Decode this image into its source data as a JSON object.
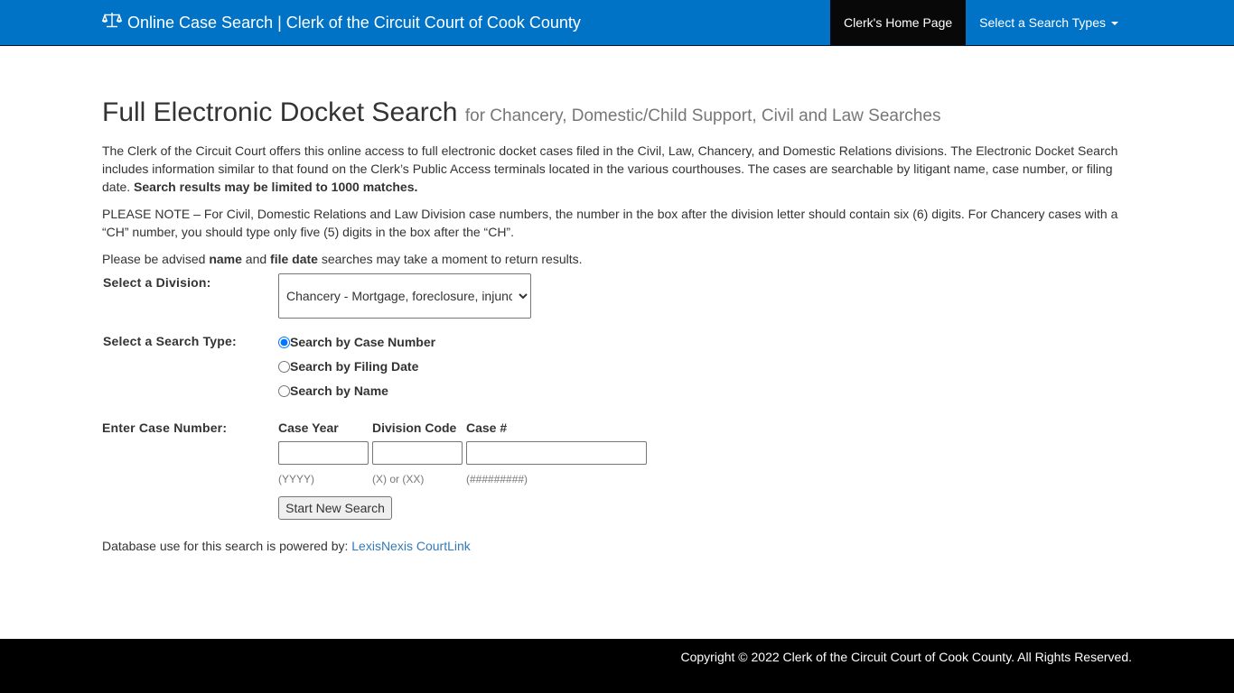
{
  "navbar": {
    "brand_icon": "balance-scale-icon",
    "brand_title": "Online Case Search | Clerk of the Circuit Court of Cook County",
    "home_link": "Clerk's Home Page",
    "search_types_menu": "Select a Search Types",
    "colors": {
      "navbar_bg": "#0073c7",
      "active_bg": "#080808"
    }
  },
  "page": {
    "title": "Full Electronic Docket Search",
    "subtitle": "for Chancery, Domestic/Child Support, Civil and Law Searches",
    "intro_text": "The Clerk of the Circuit Court offers this online access to full electronic docket cases filed in the Civil, Law, Chancery, and Domestic Relations divisions. The Electronic Docket Search includes information similar to that found on the Clerk’s Public Access terminals located in the various courthouses. The cases are searchable by litigant name, case number, or filing date.",
    "intro_bold": "Search results may be limited to 1000 matches.",
    "note_text": "PLEASE NOTE – For Civil, Domestic Relations and Law Division case numbers, the number in the box after the division letter should contain six (6) digits. For Chancery cases with a “CH” number, you should type only five (5) digits in the box after the “CH”.",
    "advise_prefix": "Please be advised",
    "advise_bold1": "name",
    "advise_and": "and",
    "advise_bold2": "file date",
    "advise_suffix": "searches may take a moment to return results."
  },
  "form": {
    "division_label": "Select a Division:",
    "division_selected": "Chancery - Mortgage, foreclosure, injunction",
    "search_type_label": "Select a Search Type:",
    "search_types": [
      {
        "label": "Search by Case Number",
        "checked": true
      },
      {
        "label": "Search by Filing Date",
        "checked": false
      },
      {
        "label": "Search by Name",
        "checked": false
      }
    ],
    "case_number_label": "Enter Case Number:",
    "fields": [
      {
        "header": "Case Year",
        "value": "",
        "hint": "(YYYY)"
      },
      {
        "header": "Division Code",
        "value": "",
        "hint": "(X) or (XX)"
      },
      {
        "header": "Case #",
        "value": "",
        "hint": "(#########)"
      }
    ],
    "submit_label": "Start New Search"
  },
  "powered_by": {
    "text": "Database use for this search is powered by:",
    "link": "LexisNexis CourtLink",
    "link_color": "#337ab7"
  },
  "footer": {
    "copyright": "Copyright © 2022 Clerk of the Circuit Court of Cook County. All Rights Reserved."
  }
}
